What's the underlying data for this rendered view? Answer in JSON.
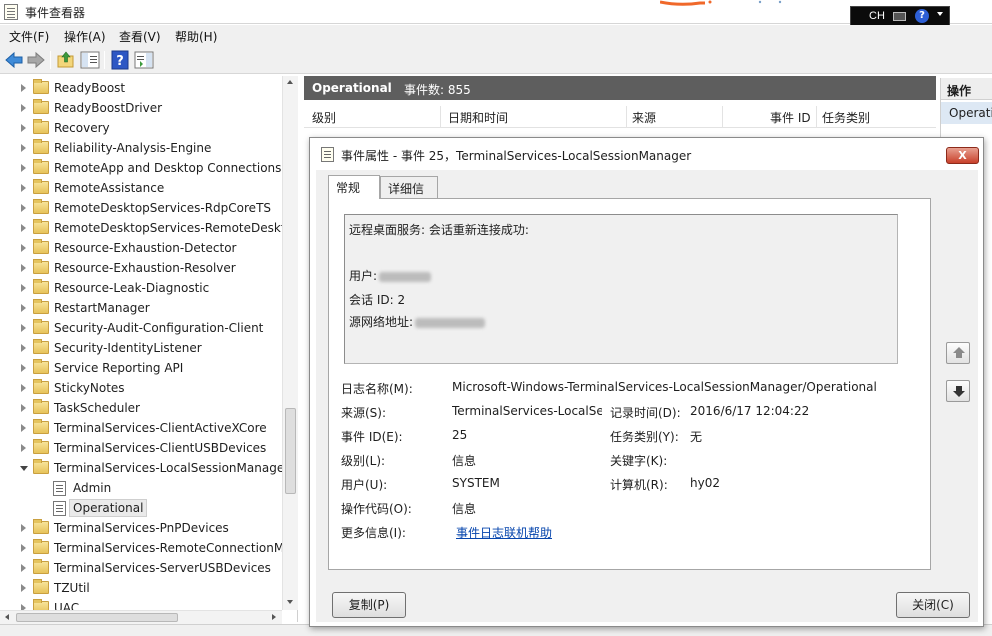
{
  "window": {
    "title": "事件查看器",
    "ime": {
      "lang": "CH"
    }
  },
  "menu": [
    "文件(F)",
    "操作(A)",
    "查看(V)",
    "帮助(H)"
  ],
  "toolbar": {
    "icons": [
      "back-arrow-icon",
      "forward-arrow-icon",
      "up-folder-icon",
      "show-hide-tree-icon",
      "help-icon",
      "show-hide-action-pane-icon"
    ]
  },
  "tree": {
    "items": [
      {
        "label": "ReadyBoost"
      },
      {
        "label": "ReadyBoostDriver"
      },
      {
        "label": "Recovery"
      },
      {
        "label": "Reliability-Analysis-Engine"
      },
      {
        "label": "RemoteApp and Desktop Connections"
      },
      {
        "label": "RemoteAssistance"
      },
      {
        "label": "RemoteDesktopServices-RdpCoreTS"
      },
      {
        "label": "RemoteDesktopServices-RemoteDeskto"
      },
      {
        "label": "Resource-Exhaustion-Detector"
      },
      {
        "label": "Resource-Exhaustion-Resolver"
      },
      {
        "label": "Resource-Leak-Diagnostic"
      },
      {
        "label": "RestartManager"
      },
      {
        "label": "Security-Audit-Configuration-Client"
      },
      {
        "label": "Security-IdentityListener"
      },
      {
        "label": "Service Reporting API"
      },
      {
        "label": "StickyNotes"
      },
      {
        "label": "TaskScheduler"
      },
      {
        "label": "TerminalServices-ClientActiveXCore"
      },
      {
        "label": "TerminalServices-ClientUSBDevices"
      },
      {
        "label": "TerminalServices-LocalSessionManager"
      }
    ],
    "children": [
      {
        "label": "Admin"
      },
      {
        "label": "Operational"
      }
    ],
    "items_after": [
      {
        "label": "TerminalServices-PnPDevices"
      },
      {
        "label": "TerminalServices-RemoteConnectionMa"
      },
      {
        "label": "TerminalServices-ServerUSBDevices"
      },
      {
        "label": "TZUtil"
      },
      {
        "label": "UAC"
      }
    ]
  },
  "center": {
    "title": "Operational",
    "count": "事件数: 855",
    "columns": [
      "级别",
      "日期和时间",
      "来源",
      "事件 ID",
      "任务类别"
    ]
  },
  "actions": {
    "header": "操作",
    "item": "Operati"
  },
  "dialog": {
    "title": "事件属性 - 事件 25，TerminalServices-LocalSessionManager",
    "close_label": "X",
    "tabs": [
      "常规",
      "详细信息"
    ],
    "description": {
      "line1": "远程桌面服务: 会话重新连接成功:",
      "user_label": "用户:",
      "session_id": "会话 ID: 2",
      "source_addr_label": "源网络地址:"
    },
    "fields": {
      "log_name_label": "日志名称(M):",
      "log_name_value": "Microsoft-Windows-TerminalServices-LocalSessionManager/Operational",
      "source_label": "来源(S):",
      "source_value": "TerminalServices-LocalSessionManager",
      "logged_label": "记录时间(D):",
      "logged_value": "2016/6/17 12:04:22",
      "event_id_label": "事件 ID(E):",
      "event_id_value": "25",
      "task_category_label": "任务类别(Y):",
      "task_category_value": "无",
      "level_label": "级别(L):",
      "level_value": "信息",
      "keywords_label": "关键字(K):",
      "keywords_value": "",
      "user_label": "用户(U):",
      "user_value": "SYSTEM",
      "computer_label": "计算机(R):",
      "computer_value": "hy02",
      "opcode_label": "操作代码(O):",
      "opcode_value": "信息",
      "more_info_label": "更多信息(I):",
      "more_info_link": "事件日志联机帮助"
    },
    "buttons": {
      "copy": "复制(P)",
      "close": "关闭(C)"
    }
  }
}
